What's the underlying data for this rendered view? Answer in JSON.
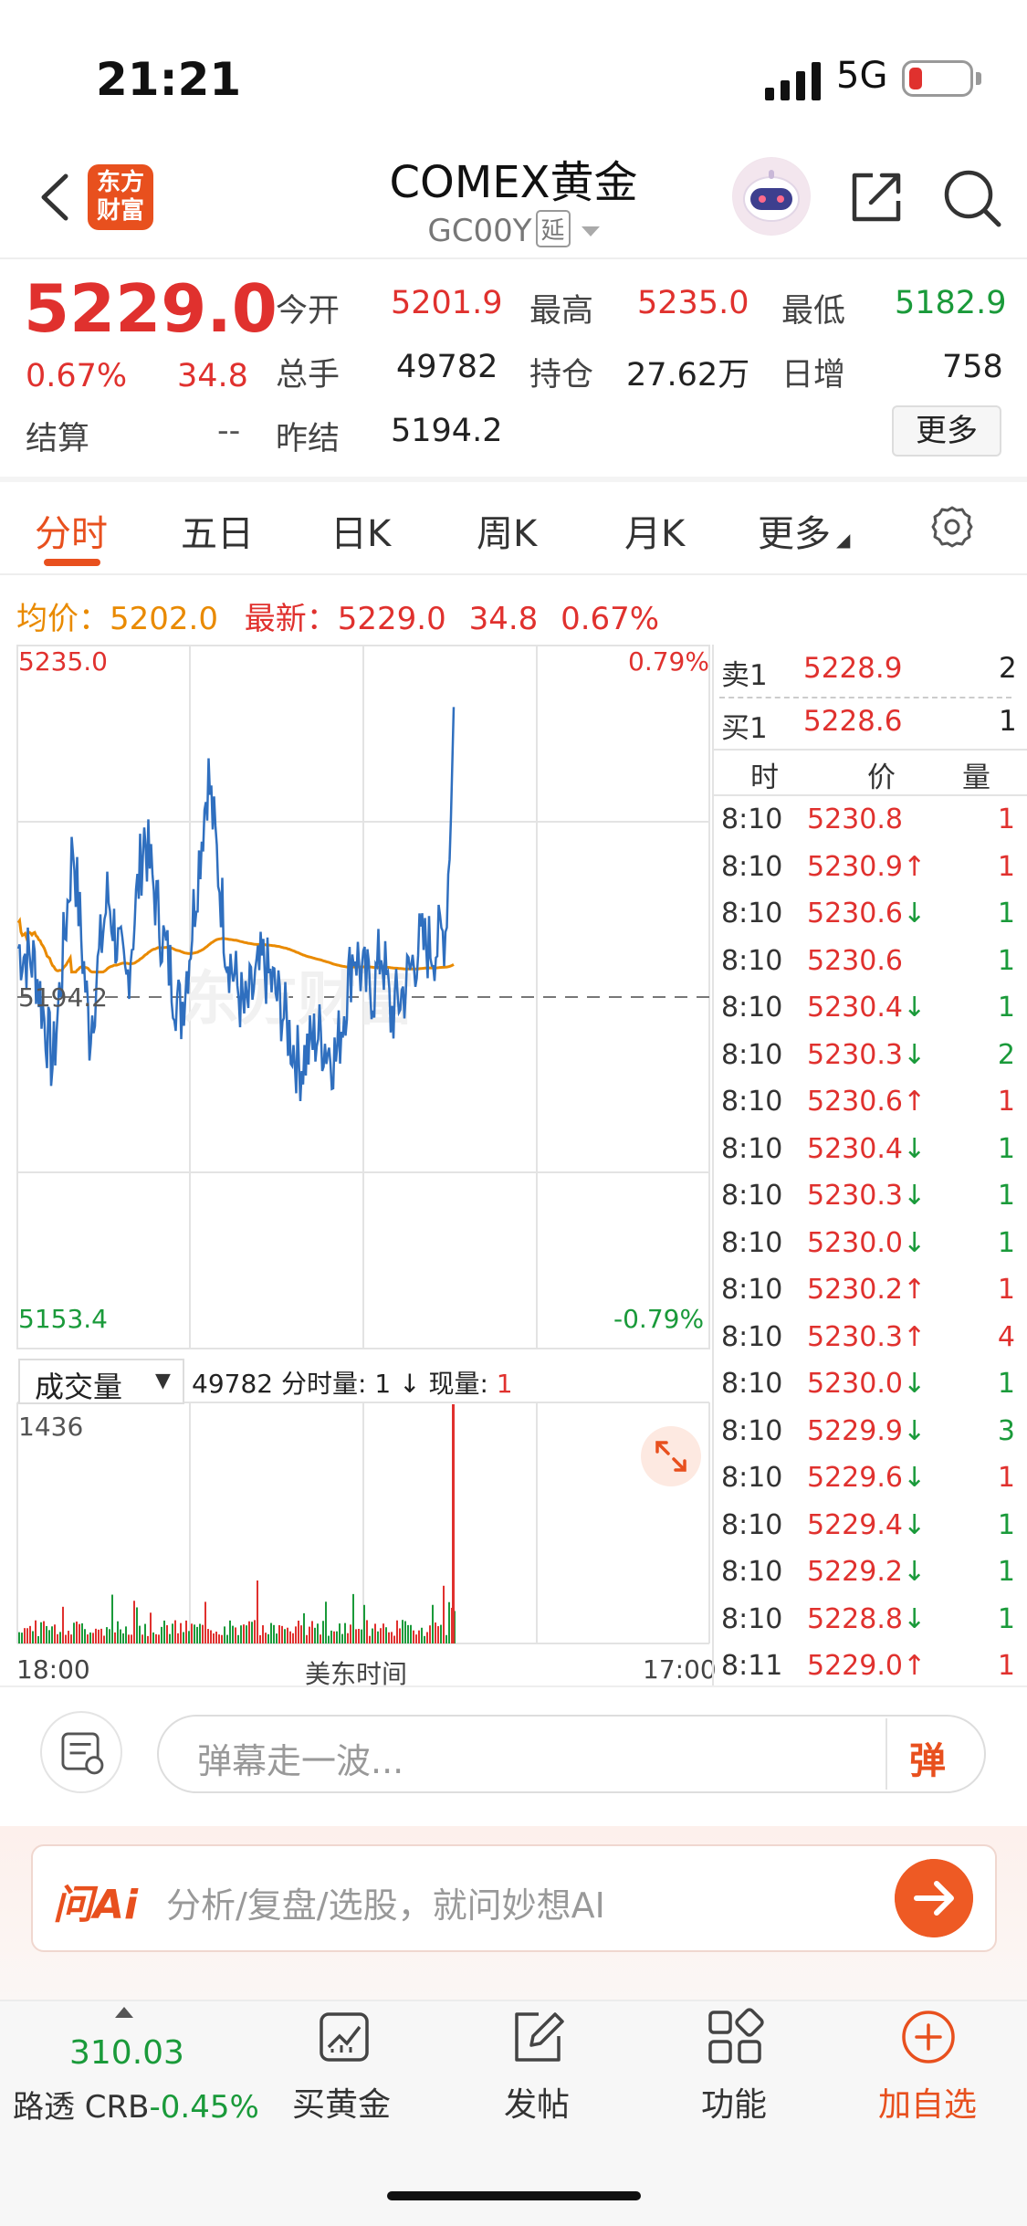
{
  "status": {
    "time": "21:21",
    "network": "5G"
  },
  "header": {
    "logo_line1": "东方",
    "logo_line2": "财富",
    "title": "COMEX黄金",
    "code": "GC00Y",
    "delay_badge": "延"
  },
  "quote": {
    "price": "5229.0",
    "change_pct": "0.67%",
    "change": "34.8",
    "settle_label": "结算",
    "settle_value": "--",
    "open_label": "今开",
    "open_value": "5201.9",
    "high_label": "最高",
    "high_value": "5235.0",
    "low_label": "最低",
    "low_value": "5182.9",
    "volume_label": "总手",
    "volume_value": "49782",
    "oi_label": "持仓",
    "oi_value": "27.62万",
    "daily_inc_label": "日增",
    "daily_inc_value": "758",
    "prev_settle_label": "昨结",
    "prev_settle_value": "5194.2",
    "more_button": "更多"
  },
  "tabs": {
    "intraday": "分时",
    "five_day": "五日",
    "day_k": "日K",
    "week_k": "周K",
    "month_k": "月K",
    "more": "更多"
  },
  "avg_line": {
    "avg_label": "均价：",
    "avg_value": "5202.0",
    "latest_label": "最新：",
    "latest_value": "5229.0",
    "chg": "34.8",
    "pct": "0.67%"
  },
  "chart": {
    "y_max": "5235.0",
    "y_ref": "5194.2",
    "y_min": "5153.4",
    "pct_max": "0.79%",
    "pct_min": "-0.79%",
    "volume_selector": "成交量",
    "volume_total": "49782",
    "minute_vol_label": "分时量:",
    "minute_vol_value": "1",
    "cur_vol_label": "现量:",
    "cur_vol_value": "1",
    "vol_max": "1436",
    "x_start": "18:00",
    "x_mid": "美东时间",
    "x_end": "17:00",
    "watermark": "东方财富",
    "colors": {
      "price": "#2f6fbf",
      "avg": "#e98a00",
      "up": "#e0312e",
      "down": "#1a9a3a"
    }
  },
  "order_book": {
    "ask_label": "卖1",
    "ask_price": "5228.9",
    "ask_vol": "2",
    "bid_label": "买1",
    "bid_price": "5228.6",
    "bid_vol": "1",
    "col_time": "时",
    "col_price": "价",
    "col_vol": "量",
    "ticks": [
      {
        "time": "8:10",
        "price": "5230.8",
        "dir": "",
        "vol": "1",
        "pc": "red",
        "vc": "red"
      },
      {
        "time": "8:10",
        "price": "5230.9",
        "dir": "↑",
        "vol": "1",
        "pc": "red",
        "vc": "red"
      },
      {
        "time": "8:10",
        "price": "5230.6",
        "dir": "↓",
        "vol": "1",
        "pc": "red",
        "vc": "green"
      },
      {
        "time": "8:10",
        "price": "5230.6",
        "dir": "",
        "vol": "1",
        "pc": "red",
        "vc": "green"
      },
      {
        "time": "8:10",
        "price": "5230.4",
        "dir": "↓",
        "vol": "1",
        "pc": "red",
        "vc": "green"
      },
      {
        "time": "8:10",
        "price": "5230.3",
        "dir": "↓",
        "vol": "2",
        "pc": "red",
        "vc": "green"
      },
      {
        "time": "8:10",
        "price": "5230.6",
        "dir": "↑",
        "vol": "1",
        "pc": "red",
        "vc": "red"
      },
      {
        "time": "8:10",
        "price": "5230.4",
        "dir": "↓",
        "vol": "1",
        "pc": "red",
        "vc": "green"
      },
      {
        "time": "8:10",
        "price": "5230.3",
        "dir": "↓",
        "vol": "1",
        "pc": "red",
        "vc": "green"
      },
      {
        "time": "8:10",
        "price": "5230.0",
        "dir": "↓",
        "vol": "1",
        "pc": "red",
        "vc": "green"
      },
      {
        "time": "8:10",
        "price": "5230.2",
        "dir": "↑",
        "vol": "1",
        "pc": "red",
        "vc": "red"
      },
      {
        "time": "8:10",
        "price": "5230.3",
        "dir": "↑",
        "vol": "4",
        "pc": "red",
        "vc": "red"
      },
      {
        "time": "8:10",
        "price": "5230.0",
        "dir": "↓",
        "vol": "1",
        "pc": "red",
        "vc": "green"
      },
      {
        "time": "8:10",
        "price": "5229.9",
        "dir": "↓",
        "vol": "3",
        "pc": "red",
        "vc": "green"
      },
      {
        "time": "8:10",
        "price": "5229.6",
        "dir": "↓",
        "vol": "1",
        "pc": "red",
        "vc": "red"
      },
      {
        "time": "8:10",
        "price": "5229.4",
        "dir": "↓",
        "vol": "1",
        "pc": "red",
        "vc": "green"
      },
      {
        "time": "8:10",
        "price": "5229.2",
        "dir": "↓",
        "vol": "1",
        "pc": "red",
        "vc": "green"
      },
      {
        "time": "8:10",
        "price": "5228.8",
        "dir": "↓",
        "vol": "1",
        "pc": "red",
        "vc": "green"
      },
      {
        "time": "8:11",
        "price": "5229.0",
        "dir": "↑",
        "vol": "1",
        "pc": "red",
        "vc": "red"
      }
    ]
  },
  "danmaku": {
    "placeholder": "弹幕走一波...",
    "button": "弹"
  },
  "ai": {
    "logo": "问Ai",
    "placeholder": "分析/复盘/选股，就问妙想AI"
  },
  "bottom_nav": {
    "crb_value": "310.03",
    "crb_label": "路透 CRB",
    "crb_change": "-0.45%",
    "buy_gold": "买黄金",
    "post": "发帖",
    "features": "功能",
    "add_watch": "加自选"
  }
}
